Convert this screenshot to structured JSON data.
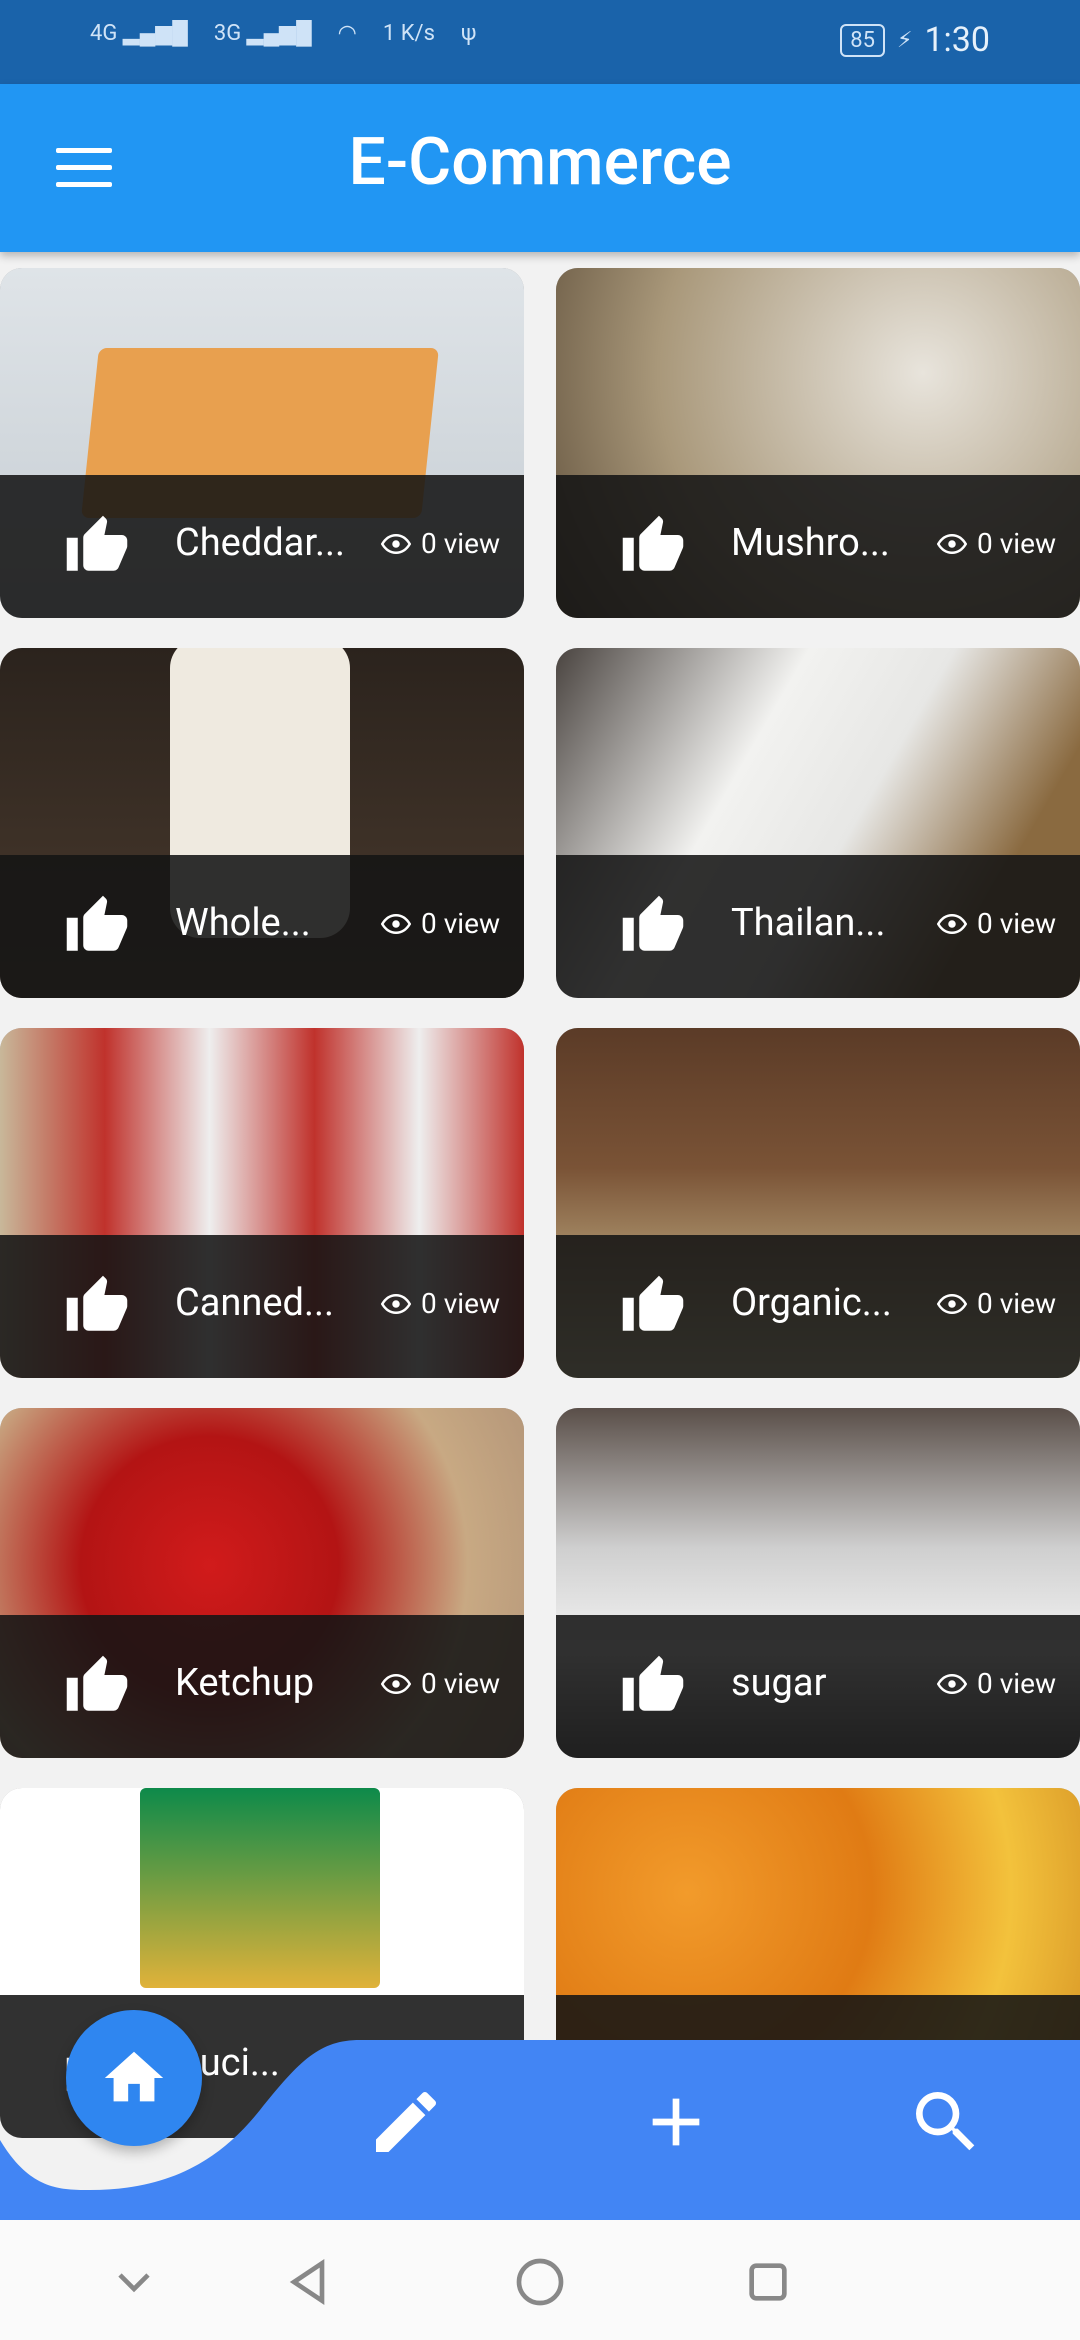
{
  "status_bar": {
    "network_1": "4G",
    "network_2": "3G",
    "speed_value": "1",
    "speed_unit": "K/s",
    "battery": "85",
    "time": "1:30"
  },
  "app_bar": {
    "title": "E-Commerce"
  },
  "products": [
    {
      "name": "Cheddar...",
      "views": "0 view",
      "image_icon": "cheddar-photo"
    },
    {
      "name": "Mushro...",
      "views": "0 view",
      "image_icon": "mushroom-photo"
    },
    {
      "name": "Whole...",
      "views": "0 view",
      "image_icon": "milk-photo"
    },
    {
      "name": "Thailan...",
      "views": "0 view",
      "image_icon": "rice-photo"
    },
    {
      "name": "Canned...",
      "views": "0 view",
      "image_icon": "canned-soup-photo"
    },
    {
      "name": "Organic...",
      "views": "0 view",
      "image_icon": "organic-photo"
    },
    {
      "name": "Ketchup",
      "views": "0 view",
      "image_icon": "ketchup-photo"
    },
    {
      "name": "sugar",
      "views": "0 view",
      "image_icon": "sugar-photo"
    },
    {
      "name": "Cuci...",
      "views": "",
      "image_icon": "macaroni-photo"
    },
    {
      "name": "",
      "views": "",
      "image_icon": "orange-juice-photo"
    }
  ],
  "bottom_nav": {
    "items": [
      "home-icon",
      "edit-icon",
      "add-icon",
      "search-icon"
    ],
    "accent": "#4285f4"
  },
  "colors": {
    "status_bar": "#1a63aa",
    "app_bar": "#2196f3",
    "card_overlay": "#141414"
  }
}
